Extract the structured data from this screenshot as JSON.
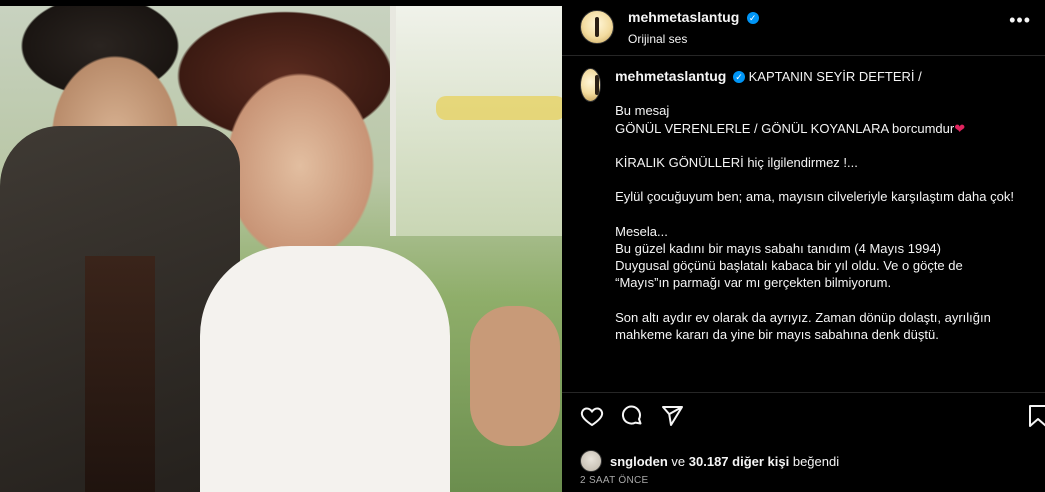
{
  "post": {
    "author": "mehmetaslantug",
    "audio_label": "Orijinal ses",
    "more_icon": "more-horizontal-icon"
  },
  "caption": {
    "author": "mehmetaslantug",
    "headline": "KAPTANIN SEYİR DEFTERİ /",
    "lines": [
      "Bu mesaj",
      "GÖNÜL VERENLERLE / GÖNÜL KOYANLARA borcumdur",
      "KİRALIK GÖNÜLLERİ hiç ilgilendirmez !...",
      "Eylül çocuğuyum ben; ama, mayısın cilveleriyle karşılaştım daha çok!",
      "Mesela...",
      "Bu güzel kadını bir mayıs sabahı tanıdım (4 Mayıs 1994)",
      "Duygusal göçünü başlatalı kabaca bir yıl oldu. Ve o göçte de",
      "“Mayıs”ın parmağı var mı gerçekten bilmiyorum.",
      "Son altı aydır ev olarak da ayrıyız. Zaman dönüp dolaştı, ayrılığın mahkeme kararı da yine bir mayıs sabahına denk düştü."
    ],
    "heart_emoji": "❤"
  },
  "likes": {
    "first_user": "sngloden",
    "connector": "ve",
    "others": "30.187 diğer kişi",
    "suffix": "beğendi"
  },
  "timestamp": "2 SAAT ÖNCE",
  "colors": {
    "background": "#000000",
    "text": "#f5f5f5",
    "secondary": "#a8a8a8",
    "verified": "#0095f6",
    "heart": "#e0245e"
  }
}
